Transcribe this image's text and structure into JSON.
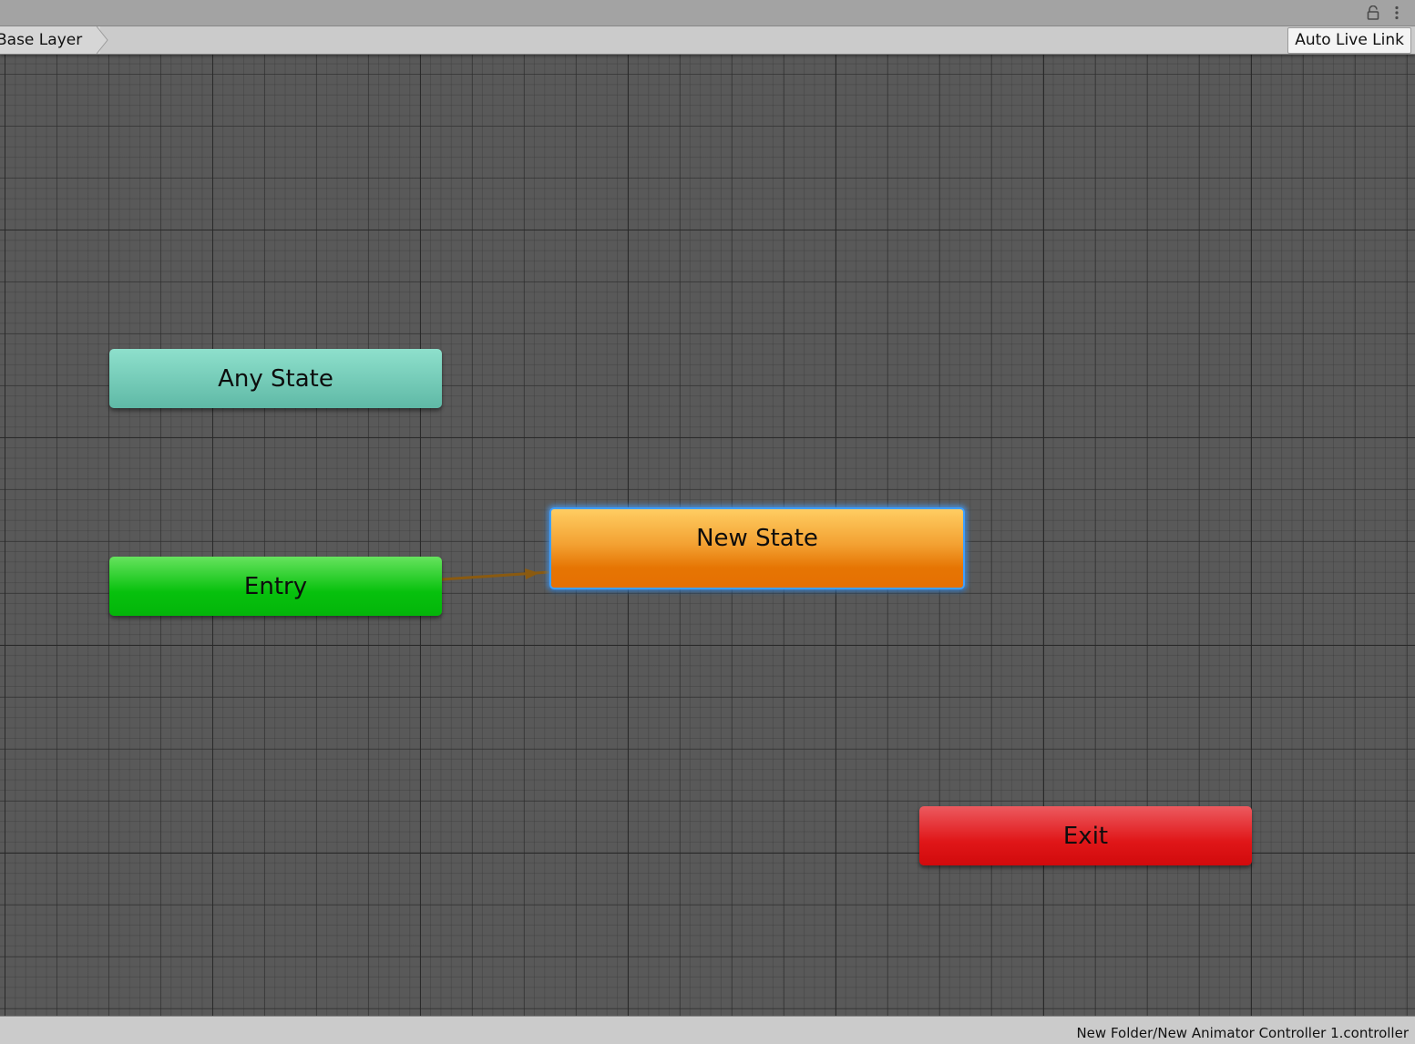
{
  "window": {
    "lock_icon": "lock-icon",
    "menu_icon": "kebab-menu-icon"
  },
  "toolbar": {
    "breadcrumb": [
      {
        "label": "Base Layer"
      }
    ],
    "live_link_label": "Auto Live Link"
  },
  "graph": {
    "states": {
      "any_state": {
        "label": "Any State",
        "color": "#6fcab6"
      },
      "entry": {
        "label": "Entry",
        "color": "#09c00f"
      },
      "new_state": {
        "label": "New State",
        "color": "#f39a2a",
        "selected": true,
        "default": true
      },
      "exit": {
        "label": "Exit",
        "color": "#de1518"
      }
    },
    "transitions": [
      {
        "from": "Entry",
        "to": "New State",
        "color": "#8a5a10"
      }
    ]
  },
  "status": {
    "asset_path": "New Folder/New Animator Controller 1.controller"
  },
  "colors": {
    "selection_outline": "#3f9fff",
    "canvas": "#595959",
    "toolbar": "#cbcbcb"
  }
}
